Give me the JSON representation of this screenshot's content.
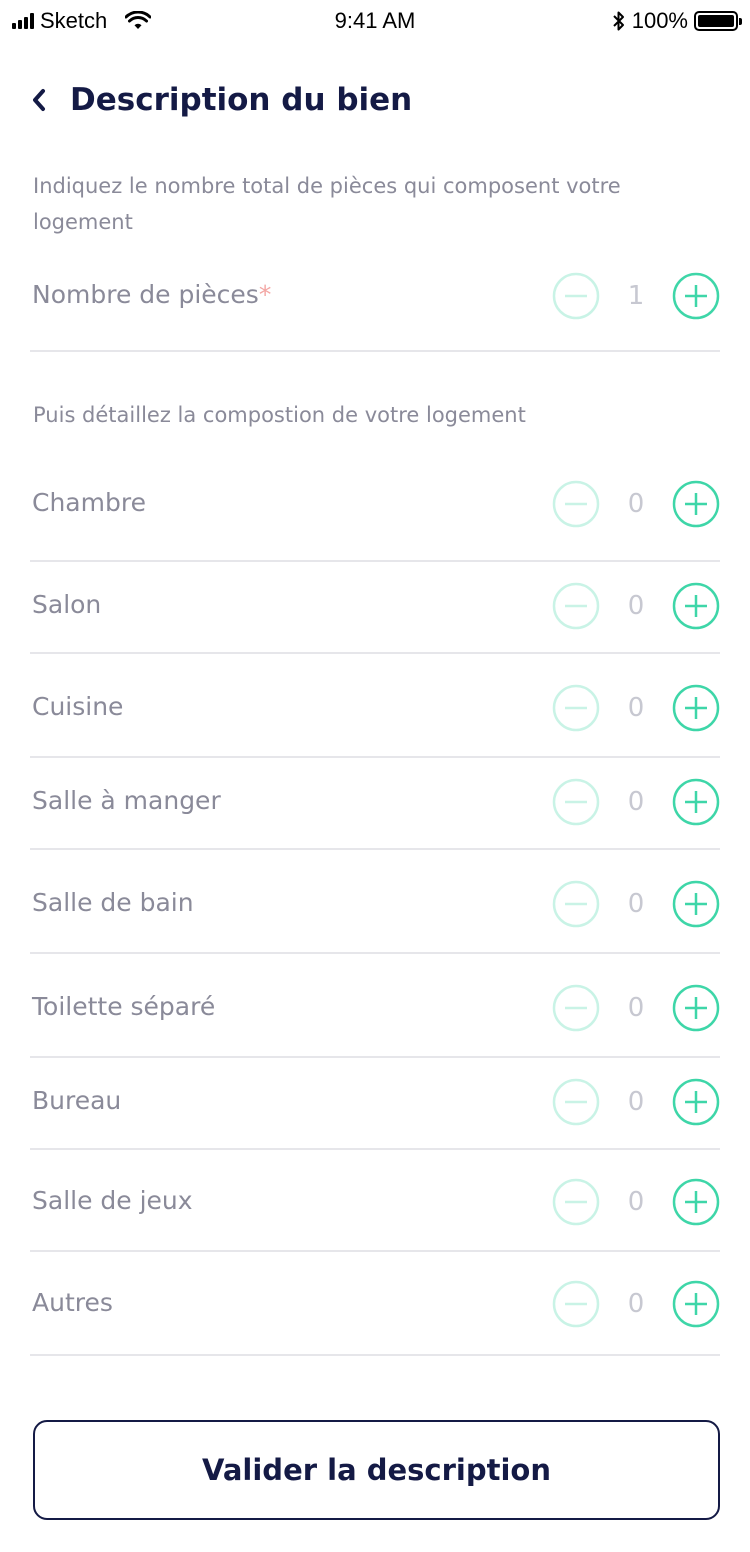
{
  "status_bar": {
    "carrier": "Sketch",
    "time": "9:41 AM",
    "battery": "100%"
  },
  "header": {
    "title": "Description du bien"
  },
  "intro": {
    "text": "Indiquez le nombre total de pièces qui composent votre logement"
  },
  "total": {
    "label": "Nombre de pièces",
    "required_mark": "*",
    "value": "1"
  },
  "composition": {
    "subtitle": "Puis détaillez la compostion de votre logement"
  },
  "rooms": [
    {
      "label": "Chambre",
      "value": "0"
    },
    {
      "label": "Salon",
      "value": "0"
    },
    {
      "label": "Cuisine",
      "value": "0"
    },
    {
      "label": "Salle à manger",
      "value": "0"
    },
    {
      "label": "Salle de bain",
      "value": "0"
    },
    {
      "label": "Toilette séparé",
      "value": "0"
    },
    {
      "label": "Bureau",
      "value": "0"
    },
    {
      "label": "Salle de jeux",
      "value": "0"
    },
    {
      "label": "Autres",
      "value": "0"
    }
  ],
  "actions": {
    "validate_label": "Valider la description"
  },
  "colors": {
    "accent": "#3ed6a8",
    "accent_disabled": "#c9f3e6",
    "navy": "#141a45",
    "required": "#f3a6a3"
  }
}
